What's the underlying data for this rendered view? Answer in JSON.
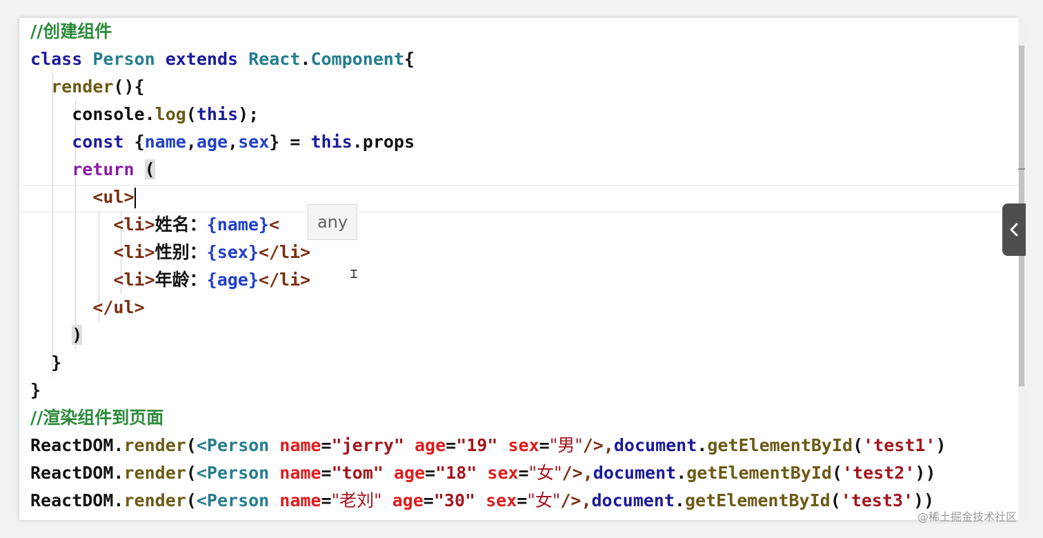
{
  "comments": {
    "create_component": "//创建组件",
    "render_to_page": "//渲染组件到页面"
  },
  "class_decl": {
    "keyword": "class",
    "name": "Person",
    "extends_keyword": "extends",
    "parent_obj": "React",
    "parent_prop": "Component",
    "open": "{"
  },
  "render_method": {
    "name": "render",
    "sig": "(){"
  },
  "console_line": {
    "obj": "console",
    "fn": "log",
    "open": "(",
    "arg": "this",
    "close": ");"
  },
  "destructure_line": {
    "keyword": "const",
    "open": "{",
    "vars": [
      "name",
      "age",
      "sex"
    ],
    "close": "}",
    "assign": " = ",
    "this_kw": "this",
    "prop": "props"
  },
  "return_line": {
    "keyword": "return",
    "paren": "("
  },
  "jsx": {
    "ul_open": "<ul>",
    "li_open": "<li>",
    "items": [
      {
        "label": "姓名：",
        "expr": "{name}",
        "close": "<"
      },
      {
        "label": "性别：",
        "expr": "{sex}",
        "close": "</li>"
      },
      {
        "label": "年龄：",
        "expr": "{age}",
        "close": "</li>"
      }
    ],
    "ul_close": "</ul>"
  },
  "closers": {
    "paren": ")",
    "method_brace": "}",
    "class_brace": "}"
  },
  "render_calls": [
    {
      "prefix": "ReactDOM",
      "method": "render",
      "comp": "<Person",
      "name": "\"jerry\"",
      "age": "\"19\"",
      "sex": "\"男\"",
      "end": "/>,",
      "doc": "document",
      "getter": "getElementById",
      "id": "'test1'",
      "tail": ")"
    },
    {
      "prefix": "ReactDOM",
      "method": "render",
      "comp": "<Person",
      "name": "\"tom\"",
      "age": "\"18\"",
      "sex": "\"女\"",
      "end": "/>,",
      "doc": "document",
      "getter": "getElementById",
      "id": "'test2'",
      "tail": "))"
    },
    {
      "prefix": "ReactDOM",
      "method": "render",
      "comp": "<Person",
      "name": "\"老刘\"",
      "age": "\"30\"",
      "sex": "\"女\"",
      "end": "/>,",
      "doc": "document",
      "getter": "getElementById",
      "id": "'test3'",
      "tail": "))"
    }
  ],
  "attr_names": {
    "name": "name",
    "age": "age",
    "sex": "sex",
    "eq": "="
  },
  "tooltip": {
    "text": "any"
  },
  "watermark": {
    "text": "@稀土掘金技术社区"
  },
  "icons": {
    "side_tab": "chevron-left-icon",
    "cursor": "text-cursor-icon"
  }
}
